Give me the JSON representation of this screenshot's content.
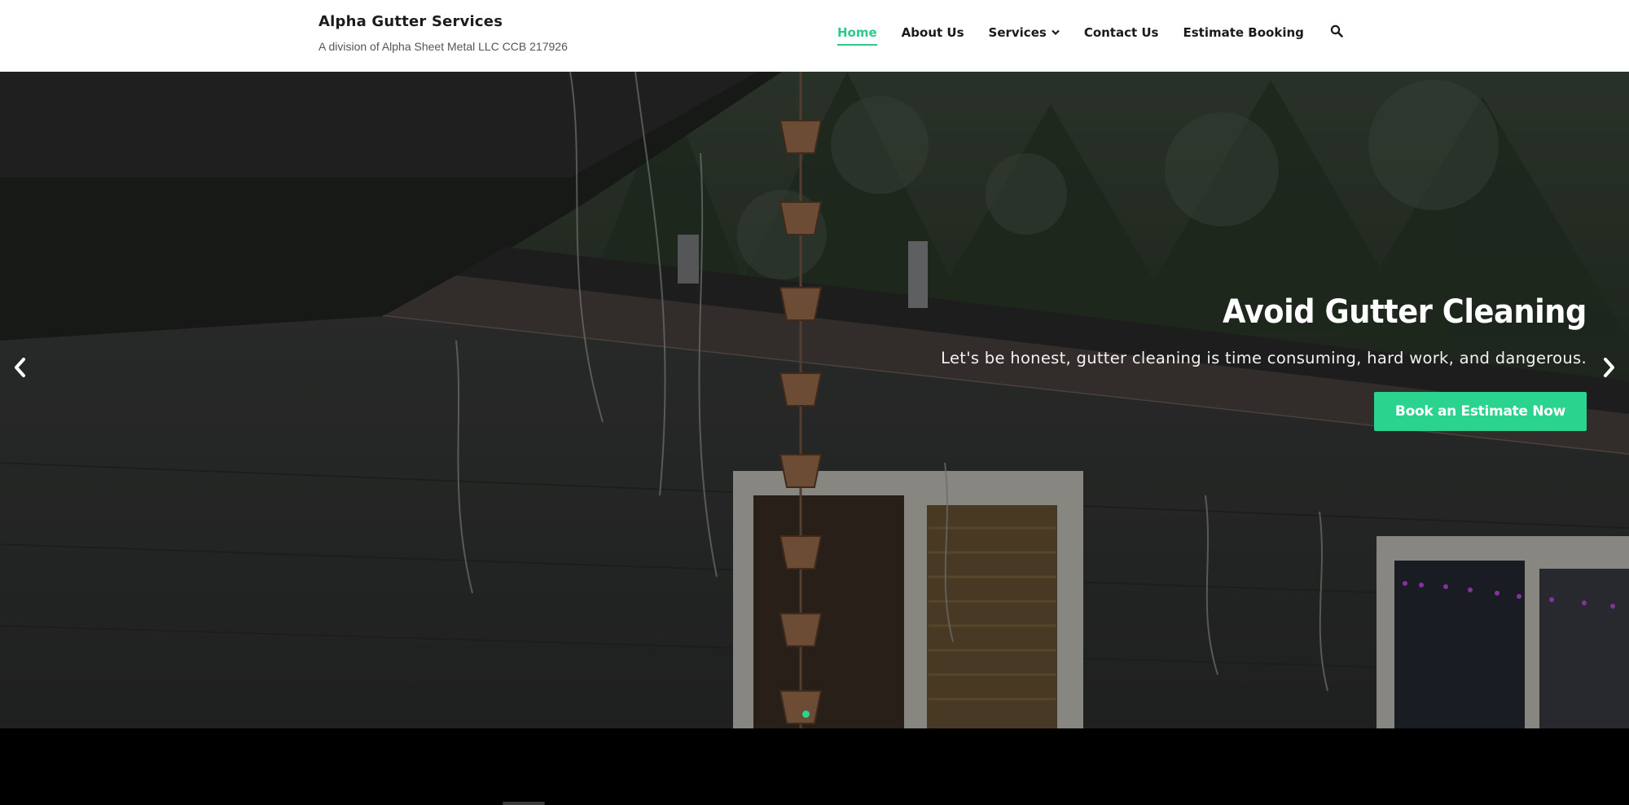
{
  "site": {
    "title": "Alpha Gutter Services",
    "tagline": "A division of Alpha Sheet Metal LLC CCB 217926"
  },
  "nav": {
    "items": [
      {
        "label": "Home",
        "active": true
      },
      {
        "label": "About Us"
      },
      {
        "label": "Services",
        "has_dropdown": true,
        "icon": "chevron-down-icon"
      },
      {
        "label": "Contact Us"
      },
      {
        "label": "Estimate Booking"
      }
    ],
    "search_icon": "search-icon"
  },
  "hero": {
    "title": "Avoid Gutter Cleaning",
    "subtitle": "Let's be honest, gutter cleaning is time consuming, hard work, and dangerous.",
    "cta_label": "Book an Estimate Now",
    "prev_icon": "chevron-left-icon",
    "next_icon": "chevron-right-icon",
    "slide_count": 1,
    "active_slide": 1
  },
  "colors": {
    "accent": "#2ad38e",
    "header_bg": "#ffffff",
    "text_dark": "#1a1a1a"
  }
}
